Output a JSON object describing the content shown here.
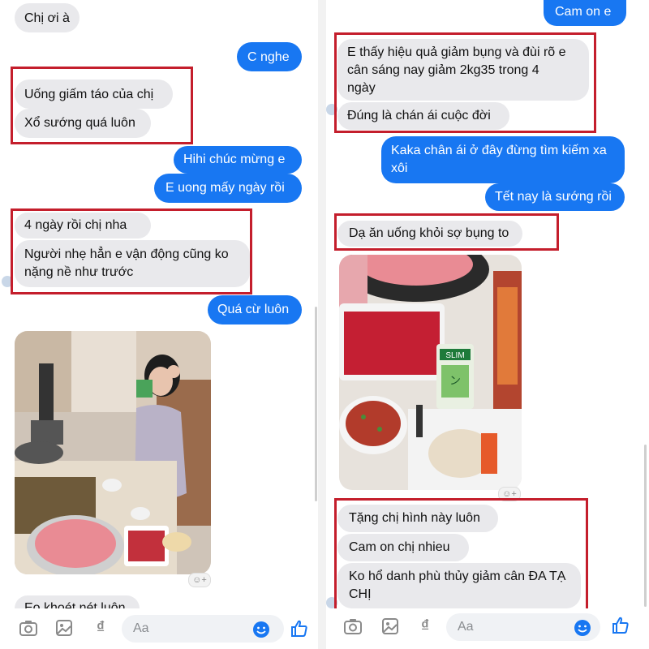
{
  "left": {
    "messages": [
      {
        "id": "l1",
        "dir": "in",
        "lines": [
          "Chị ơi à"
        ]
      },
      {
        "id": "l2",
        "dir": "out",
        "lines": [
          "C nghe"
        ]
      },
      {
        "id": "l3",
        "dir": "in",
        "lines": [
          "Uống giấm táo của chị"
        ]
      },
      {
        "id": "l4",
        "dir": "in",
        "lines": [
          "Xổ sướng quá luôn"
        ]
      },
      {
        "id": "l5",
        "dir": "out",
        "lines": [
          "Hihi chúc mừng e"
        ]
      },
      {
        "id": "l6",
        "dir": "out",
        "lines": [
          "E uong mấy ngày rồi"
        ]
      },
      {
        "id": "l7",
        "dir": "in",
        "lines": [
          "4 ngày rồi chị nha"
        ]
      },
      {
        "id": "l8",
        "dir": "in",
        "lines": [
          "Người nhẹ hẳn e vận động cũng ko",
          "nặng nề như trước"
        ]
      },
      {
        "id": "l9",
        "dir": "out",
        "lines": [
          "Quá cừ luôn"
        ]
      },
      {
        "id": "l10",
        "dir": "in",
        "lines": [
          "Eo khoét nét luôn"
        ]
      }
    ],
    "input_placeholder": "Aa",
    "photo_label": "woman at hotpot restaurant"
  },
  "right": {
    "messages": [
      {
        "id": "r1",
        "dir": "out",
        "lines": [
          "Cam on e"
        ]
      },
      {
        "id": "r2",
        "dir": "in",
        "lines": [
          "E thấy hiệu quả giảm bụng và đùi rõ e",
          "cân sáng nay giảm 2kg35 trong 4",
          "ngày"
        ]
      },
      {
        "id": "r3",
        "dir": "in",
        "lines": [
          "Đúng là chán ái cuộc đời"
        ]
      },
      {
        "id": "r4",
        "dir": "out",
        "lines": [
          "Kaka chân ái ở đây đừng tìm kiếm xa",
          "xôi"
        ]
      },
      {
        "id": "r5",
        "dir": "out",
        "lines": [
          "Tết nay là sướng rồi"
        ]
      },
      {
        "id": "r6",
        "dir": "in",
        "lines": [
          "Dạ ăn uống khỏi sợ bụng to"
        ]
      },
      {
        "id": "r7",
        "dir": "in",
        "lines": [
          "Tặng chị hình này luôn"
        ]
      },
      {
        "id": "r8",
        "dir": "in",
        "lines": [
          "Cam on chị nhieu"
        ]
      },
      {
        "id": "r9",
        "dir": "in",
        "lines": [
          "Ko hổ danh phù thủy giảm cân ĐA TẠ",
          "CHỊ"
        ]
      }
    ],
    "input_placeholder": "Aa",
    "product_label": [
      "SLIM",
      "ン"
    ],
    "photo_label": "hotpot table with beef and slim drink"
  },
  "icons": [
    "camera-icon",
    "gallery-icon",
    "dong-currency-icon",
    "emoji-icon",
    "like-thumb-icon"
  ],
  "colors": {
    "outgoing": "#1877f2",
    "incoming": "#e9e9ec",
    "highlight": "#c41e2c"
  }
}
